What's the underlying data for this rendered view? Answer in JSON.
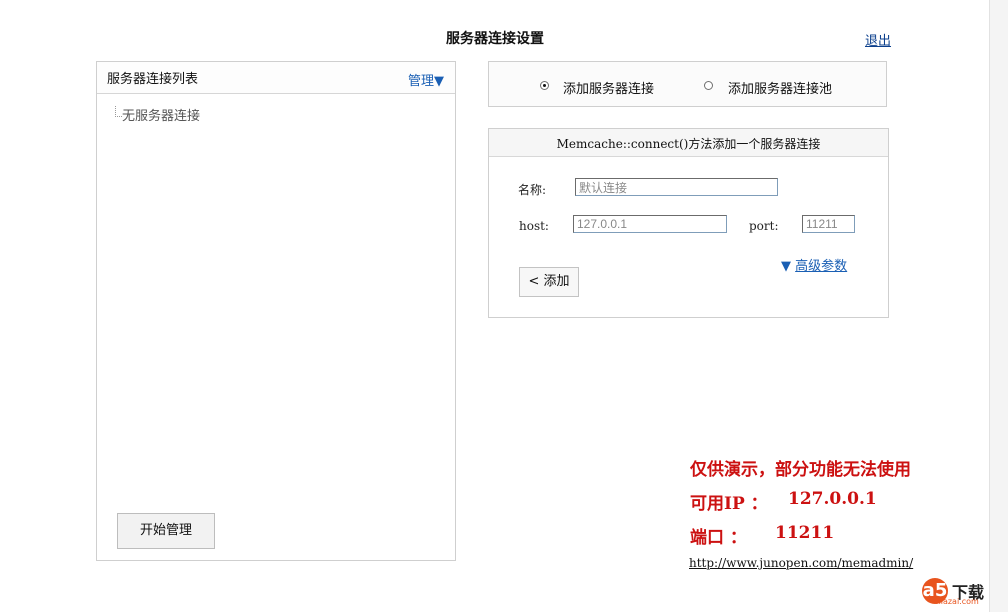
{
  "header": {
    "title": "服务器连接设置",
    "logout_label": "退出"
  },
  "left_panel": {
    "title": "服务器连接列表",
    "manage_label": "管理▼",
    "tree_items": [
      "无服务器连接"
    ],
    "start_button_label": "开始管理"
  },
  "connection_type": {
    "options": [
      {
        "label": "添加服务器连接",
        "checked": true
      },
      {
        "label": "添加服务器连接池",
        "checked": false
      }
    ]
  },
  "form": {
    "title": "Memcache::connect()方法添加一个服务器连接",
    "name_label": "名称:",
    "name_value": "默认连接",
    "host_label": "host:",
    "host_value": "127.0.0.1",
    "port_label": "port:",
    "port_value": "11211",
    "advanced_arrow": "▼",
    "advanced_label": "高级参数",
    "add_button_label": "< 添加"
  },
  "notice": {
    "line1": "仅供演示，部分功能无法使用",
    "ip_label": "可用IP ：",
    "ip_value": "127.0.0.1",
    "port_label": "端口 ：",
    "port_value": "11211",
    "url": "http://www.junopen.com/memadmin/"
  },
  "watermark": {
    "logo_letter": "a",
    "digit": "5",
    "text": "下载",
    "site": "xiazai.com"
  },
  "colors": {
    "link_blue": "#1a5fb4",
    "notice_red": "#cc1111",
    "watermark_orange": "#e8541e"
  }
}
